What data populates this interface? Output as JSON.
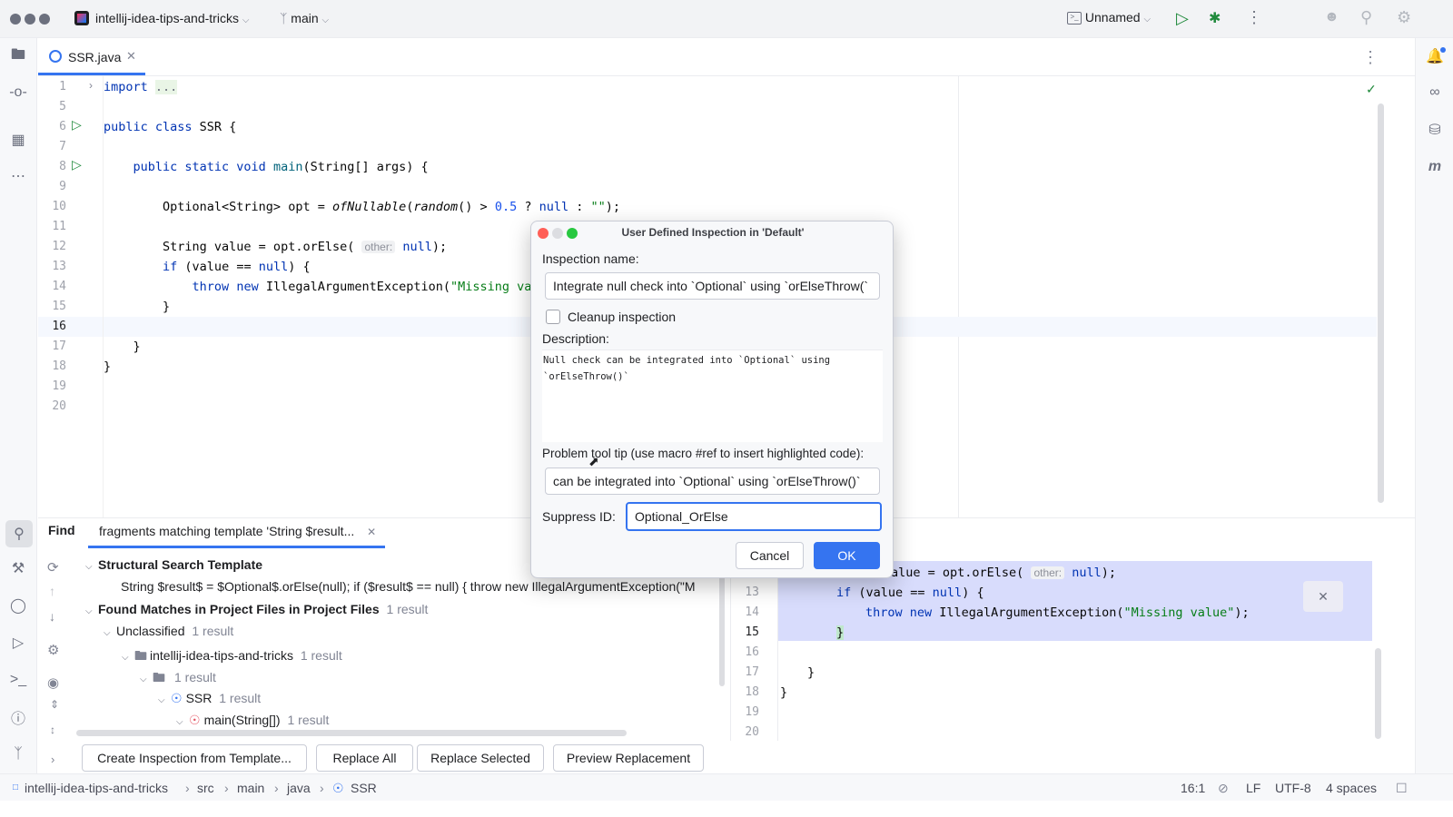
{
  "titlebar": {
    "project": "intellij-idea-tips-and-tricks",
    "branch": "main",
    "run_config": "Unnamed"
  },
  "editor_tab": {
    "filename": "SSR.java"
  },
  "editor": {
    "lines": [
      {
        "n": "1",
        "text": "import ..."
      },
      {
        "n": "5",
        "text": ""
      },
      {
        "n": "6",
        "text": "public class SSR {"
      },
      {
        "n": "7",
        "text": ""
      },
      {
        "n": "8",
        "text": "public static void main(String[] args) {"
      },
      {
        "n": "9",
        "text": ""
      },
      {
        "n": "10",
        "text": "Optional<String> opt = ofNullable(random() > 0.5 ? null : \"\");"
      },
      {
        "n": "11",
        "text": ""
      },
      {
        "n": "12",
        "text": "String value = opt.orElse( other: null);"
      },
      {
        "n": "13",
        "text": "if (value == null) {"
      },
      {
        "n": "14",
        "text": "throw new IllegalArgumentException(\"Missing valu"
      },
      {
        "n": "15",
        "text": "}"
      },
      {
        "n": "16",
        "text": ""
      },
      {
        "n": "17",
        "text": "}"
      },
      {
        "n": "18",
        "text": "}"
      },
      {
        "n": "19",
        "text": ""
      },
      {
        "n": "20",
        "text": ""
      }
    ]
  },
  "find": {
    "label": "Find",
    "tab": "fragments matching template 'String $result...",
    "template_header": "Structural Search Template",
    "template_text": "String $result$ = $Optional$.orElse(null); if ($result$ == null) {     throw new IllegalArgumentException(\"M",
    "matches_header": "Found Matches in Project Files in Project Files",
    "matches_count": "1 result",
    "unclassified": "Unclassified",
    "unclassified_count": "1 result",
    "project_node": "intellij-idea-tips-and-tricks",
    "project_count": "1 result",
    "folder_count": "1 result",
    "class_node": "SSR",
    "class_count": "1 result",
    "method_node": "main(String[])",
    "method_count": "1 result",
    "buttons": {
      "create": "Create Inspection from Template...",
      "replace_all": "Replace All",
      "replace_selected": "Replace Selected",
      "preview": "Preview Replacement"
    },
    "preview": {
      "lines": [
        {
          "n": "12",
          "text": "alue = opt.orElse( other: null);"
        },
        {
          "n": "13",
          "text": "if (value == null) {"
        },
        {
          "n": "14",
          "text": "throw new IllegalArgumentException(\"Missing value\");"
        },
        {
          "n": "15",
          "text": "}"
        },
        {
          "n": "16",
          "text": ""
        },
        {
          "n": "17",
          "text": "}"
        },
        {
          "n": "18",
          "text": "}"
        },
        {
          "n": "19",
          "text": ""
        },
        {
          "n": "20",
          "text": ""
        }
      ]
    }
  },
  "dialog": {
    "title": "User Defined Inspection in 'Default'",
    "name_label": "Inspection name:",
    "name_value": "Integrate null check into `Optional` using `orElseThrow(`",
    "cleanup_label": "Cleanup inspection",
    "description_label": "Description:",
    "description_value": "Null check can be integrated into `Optional` using `orElseThrow()`",
    "tooltip_label": "Problem tool tip (use macro #ref to insert highlighted code):",
    "tooltip_value": "can be integrated into `Optional` using `orElseThrow()`",
    "suppress_label": "Suppress ID:",
    "suppress_value": "Optional_OrElse",
    "cancel": "Cancel",
    "ok": "OK"
  },
  "statusbar": {
    "crumbs": [
      "intellij-idea-tips-and-tricks",
      "src",
      "main",
      "java",
      "SSR"
    ],
    "position": "16:1",
    "line_sep": "LF",
    "encoding": "UTF-8",
    "indent": "4 spaces"
  }
}
